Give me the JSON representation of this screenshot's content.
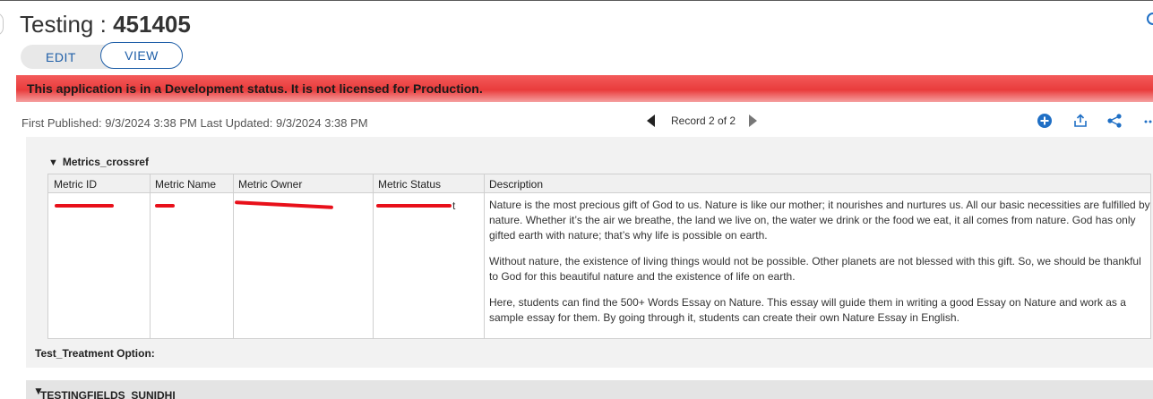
{
  "header": {
    "title": "Testing : ",
    "record_id": "451405"
  },
  "mode_toggle": {
    "edit_label": "EDIT",
    "view_label": "VIEW",
    "selected": "VIEW"
  },
  "banner": {
    "text": "This application is in a Development status. It is not licensed for Production."
  },
  "record_meta": {
    "text": "First Published: 9/3/2024 3:38 PM Last Updated: 9/3/2024 3:38 PM"
  },
  "pager": {
    "label": "Record 2 of 2"
  },
  "toolbar": {
    "icons": [
      "add-icon",
      "export-icon",
      "share-icon",
      "more-icon"
    ],
    "accent_color": "#1f6fc5"
  },
  "metrics_section": {
    "title": "Metrics_crossref",
    "columns": [
      "Metric ID",
      "Metric Name",
      "Metric Owner",
      "Metric Status",
      "Description"
    ],
    "row": {
      "status_suffix": "t",
      "description": [
        "Nature is the most precious gift of God to us. Nature is like our mother; it nourishes and nurtures us. All our basic necessities are fulfilled by nature. Whether it’s the air we breathe, the land we live on, the water we drink or the food we eat, it all comes from nature. God has only gifted earth with nature; that’s why life is possible on earth.",
        "Without nature, the existence of living things would not be possible. Other planets are not blessed with this gift. So, we should be thankful to God for this beautiful nature and the existence of life on earth.",
        "Here, students can find the 500+ Words Essay on Nature. This essay will guide them in writing a good Essay on Nature and work as a sample essay for them. By going through it, students can create their own Nature Essay in English."
      ]
    }
  },
  "treatment_field": {
    "label": "Test_Treatment Option:"
  },
  "section2": {
    "title": "TESTINGFIELDS_SUNIDHI"
  },
  "colors": {
    "banner_red": "#e93c3c",
    "link_blue": "#1f5fa8",
    "redaction": "#e8101a"
  }
}
